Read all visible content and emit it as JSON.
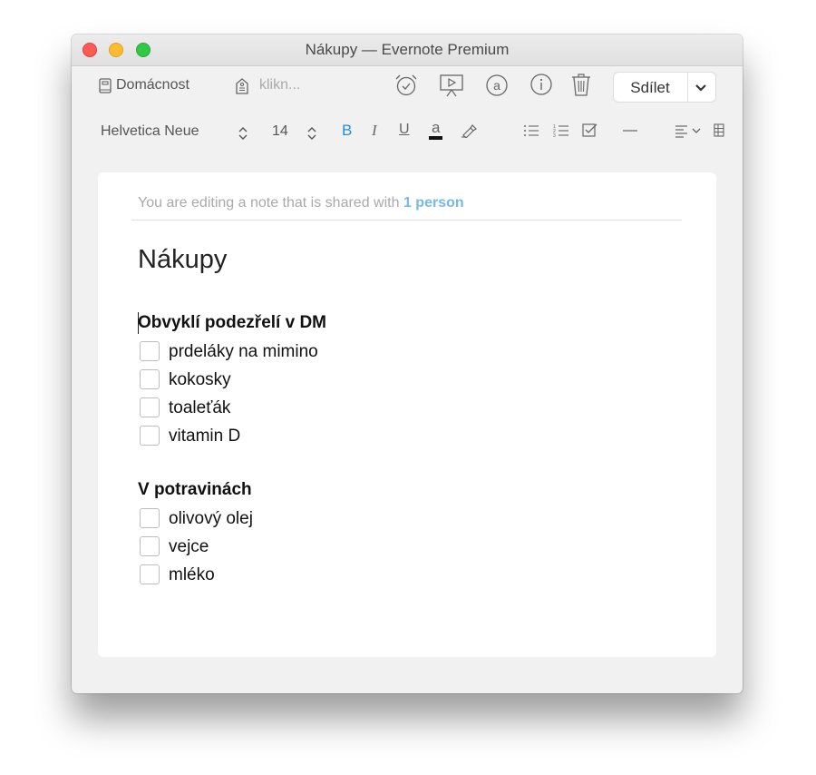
{
  "window": {
    "title": "Nákupy — Evernote Premium"
  },
  "toolbar": {
    "notebook": "Domácnost",
    "tag_placeholder": "klikn...",
    "share_label": "Sdílet",
    "font_family": "Helvetica Neue",
    "font_size": "14",
    "bold_label": "B",
    "italic_label": "I",
    "underline_label": "U",
    "text_color_label": "a"
  },
  "note": {
    "shared_prefix": "You are editing a note that is shared with",
    "shared_count": "1 person",
    "title": "Nákupy",
    "sections": [
      {
        "heading": "Obvyklí podezřelí v DM",
        "items": [
          "prdeláky na mimino",
          "kokosky",
          "toaleťák",
          "vitamin D"
        ]
      },
      {
        "heading": "V potravinách",
        "items": [
          "olivový olej",
          "vejce",
          "mléko"
        ]
      }
    ]
  },
  "colors": {
    "accent": "#1d8fe0",
    "shared_link": "#79b7e9",
    "close": "#fc5b57",
    "minimize": "#fdbc2e",
    "zoom": "#33c748"
  }
}
